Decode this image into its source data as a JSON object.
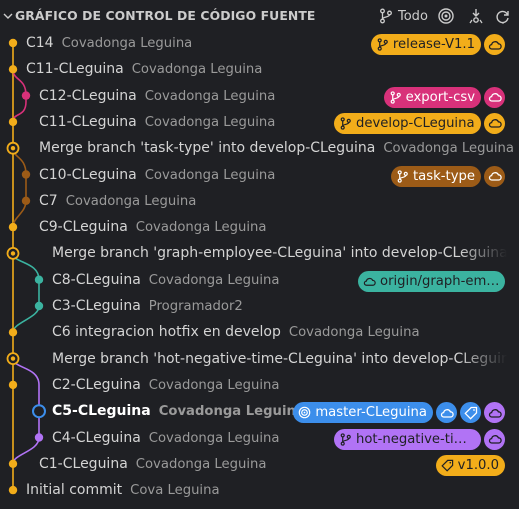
{
  "header": {
    "title": "GRÁFICO DE CONTROL DE CÓDIGO FUENTE",
    "filter_label": "Todo"
  },
  "colors": {
    "yellow": "#f2ad1a",
    "pink": "#d8317a",
    "brown": "#9c5b17",
    "teal": "#3bb3a0",
    "purple": "#b173f5",
    "blue": "#3c8eeb",
    "background": "#1f2024"
  },
  "commits": [
    {
      "message": "C14",
      "author": "Covadonga Leguina",
      "refs": [
        {
          "label": "release-V1.1",
          "icon": "branch-icon",
          "color": "#f2ad1a",
          "cloud": true
        }
      ]
    },
    {
      "message": "C11-CLeguina",
      "author": "Covadonga Leguina",
      "refs": []
    },
    {
      "message": "C12-CLeguina",
      "author": "Covadonga Leguina",
      "refs": [
        {
          "label": "export-csv",
          "icon": "branch-icon",
          "color": "#d8317a",
          "cloud": true
        }
      ]
    },
    {
      "message": "C11-CLeguina",
      "author": "Covadonga Leguina",
      "refs": [
        {
          "label": "develop-CLeguina",
          "icon": "branch-icon",
          "color": "#f2ad1a",
          "cloud": true
        }
      ]
    },
    {
      "message": "Merge branch 'task-type' into develop-CLeguina",
      "author": "Covadonga Leguina",
      "refs": []
    },
    {
      "message": "C10-CLeguina",
      "author": "Covadonga Leguina",
      "refs": [
        {
          "label": "task-type",
          "icon": "branch-icon",
          "color": "#9c5b17",
          "cloud": true
        }
      ]
    },
    {
      "message": "C7",
      "author": "Covadonga Leguina",
      "refs": []
    },
    {
      "message": "C9-CLeguina",
      "author": "Covadonga Leguina",
      "refs": []
    },
    {
      "message": "Merge branch 'graph-employee-CLeguina' into develop-CLeguina",
      "author": "",
      "refs": []
    },
    {
      "message": "C8-CLeguina",
      "author": "Covadonga Leguina",
      "refs": [
        {
          "label": "origin/graph-em…",
          "icon": "cloud-icon",
          "color": "#3bb3a0",
          "cloud": false
        }
      ]
    },
    {
      "message": "C3-CLeguina",
      "author": "Programador2",
      "refs": []
    },
    {
      "message": "C6 integracion hotfix en develop",
      "author": "Covadonga Leguina",
      "refs": []
    },
    {
      "message": "Merge branch 'hot-negative-time-CLeguina' into develop-CLeguina",
      "author": "",
      "refs": []
    },
    {
      "message": "C2-CLeguina",
      "author": "Covadonga Leguina",
      "refs": []
    },
    {
      "message": "C5-CLeguina",
      "author": "Covadonga Leguina",
      "current": true,
      "refs": [
        {
          "label": "master-CLeguina",
          "icon": "target-icon",
          "color": "#3c8eeb",
          "cloud": true,
          "tagicon": true
        }
      ]
    },
    {
      "message": "C4-CLeguina",
      "author": "Covadonga Leguina",
      "refs": [
        {
          "label": "hot-negative-ti…",
          "icon": "branch-icon",
          "color": "#b173f5",
          "cloud": true
        }
      ]
    },
    {
      "message": "C1-CLeguina",
      "author": "Covadonga Leguina",
      "refs": [
        {
          "label": "v1.0.0",
          "icon": "tag-icon",
          "color": "#f2ad1a",
          "cloud": false
        }
      ]
    },
    {
      "message": "Initial commit",
      "author": "Cova Leguina",
      "refs": []
    }
  ]
}
